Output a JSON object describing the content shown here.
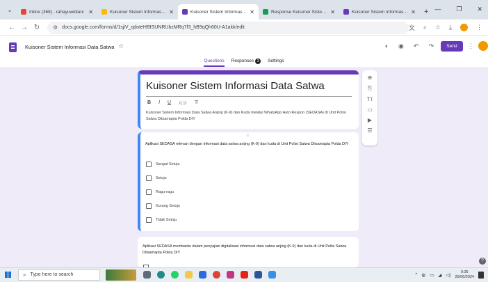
{
  "browser": {
    "tabs": [
      {
        "title": "Inbox (368) - rahayuwidiani",
        "icon": "gmail-icon",
        "color": "#ea4335",
        "active": false
      },
      {
        "title": "Kuisoner Sistem Informasi D",
        "icon": "drive-icon",
        "color": "#fbbc04",
        "active": false
      },
      {
        "title": "Kuisoner Sistem Informasi D",
        "icon": "forms-icon",
        "color": "#673ab7",
        "active": true
      },
      {
        "title": "Response Kuisoner Sistem I",
        "icon": "sheets-icon",
        "color": "#0f9d58",
        "active": false
      },
      {
        "title": "Kuisoner Sistem Informasi D",
        "icon": "forms-icon",
        "color": "#673ab7",
        "active": false
      }
    ],
    "url": "docs.google.com/forms/d/1sjiV_qdoteHBISUNRUbzMRq7f3_hB9qQh60U-A1akk/edit"
  },
  "forms_header": {
    "doc_title": "Kuisoner Sistem Informasi Data Satwa",
    "send_label": "Send",
    "tabs": [
      {
        "label": "Questions",
        "active": true
      },
      {
        "label": "Responses",
        "active": false,
        "badge": "3"
      },
      {
        "label": "Settings",
        "active": false
      }
    ]
  },
  "form": {
    "title": "Kuisoner Sistem Informasi Data Satwa",
    "description": "Kuisoner Sistem Informasi Data Satwa Anjing (K-9) dan Kuda melalui WhatsApp Auto Respon (SEDASA) di Unit Polisi Satwa Ditsamapta Polda DIY",
    "questions": [
      {
        "text": "Aplikasi SEDASA relevan dengan informasi data satwa anjing (K-9) dan kuda di Unit Polisi Satwa Ditsamapta Polda DIY",
        "options": [
          "Sangat Setuju",
          "Setuju",
          "Ragu-ragu",
          "Kurang Setuju",
          "Tidak Setuju"
        ]
      },
      {
        "text": "Aplikasi SEDASA membantu dalam penyajian digitalisasi informasi data satwa anjing (K-9) dan kuda di Unit Polisi Satwa Ditsamapta Polda DIY"
      }
    ]
  },
  "taskbar": {
    "search_placeholder": "Type here to search",
    "time": "0:35",
    "date": "25/06/2024"
  },
  "colors": {
    "accent": "#673ab7",
    "focus_blue": "#4285f4",
    "page_bg": "#f0ebf8"
  }
}
